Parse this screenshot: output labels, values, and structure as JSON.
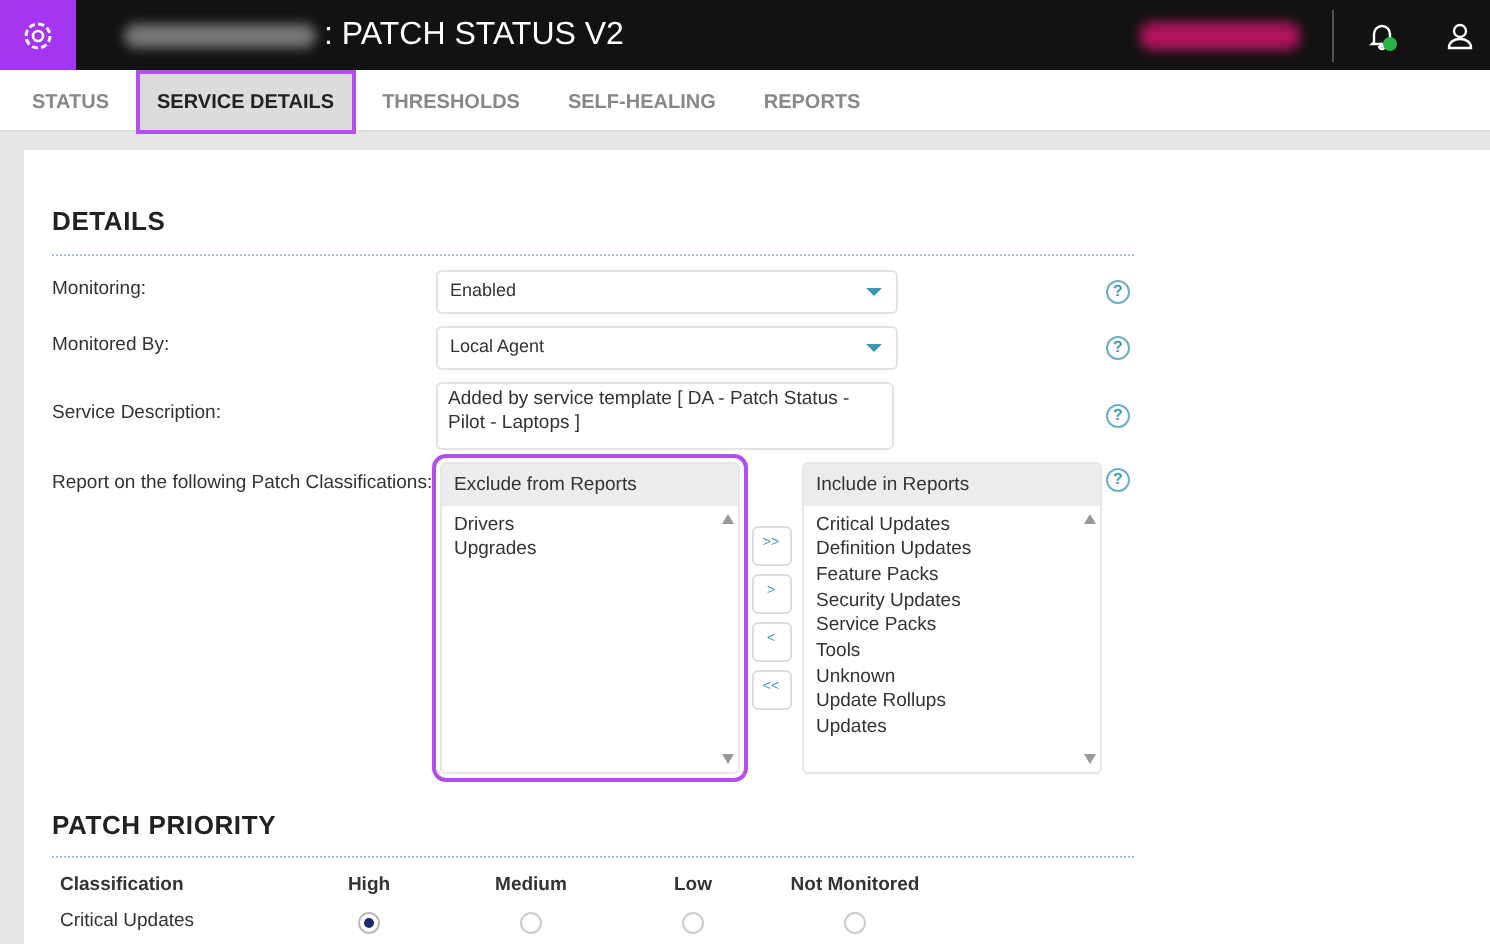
{
  "header": {
    "title": ": PATCH STATUS V2",
    "alerts_ok": true
  },
  "tabs": [
    {
      "label": "STATUS",
      "selected": false,
      "highlighted": false
    },
    {
      "label": "SERVICE DETAILS",
      "selected": true,
      "highlighted": true
    },
    {
      "label": "THRESHOLDS",
      "selected": false,
      "highlighted": false
    },
    {
      "label": "SELF-HEALING",
      "selected": false,
      "highlighted": false
    },
    {
      "label": "REPORTS",
      "selected": false,
      "highlighted": false
    }
  ],
  "details": {
    "heading": "DETAILS",
    "fields": [
      {
        "kind": "select",
        "label": "Monitoring:",
        "value": "Enabled",
        "help": "?"
      },
      {
        "kind": "select",
        "label": "Monitored By:",
        "value": "Local Agent",
        "help": "?"
      },
      {
        "kind": "textarea",
        "label": "Service Description:",
        "value": "Added by service template [ DA - Patch Status - Pilot - Laptops ]",
        "help": "?"
      },
      {
        "kind": "dual_list",
        "label": "Report on the following Patch Classifications:",
        "help": "?",
        "left": {
          "title": "Exclude from Reports",
          "highlighted": true,
          "items": [
            "Drivers",
            "Upgrades"
          ]
        },
        "right": {
          "title": "Include in Reports",
          "items": [
            "Critical Updates",
            "Definition Updates",
            "Feature Packs",
            "Security Updates",
            "Service Packs",
            "Tools",
            "Unknown",
            "Update Rollups",
            "Updates"
          ]
        },
        "buttons": [
          ">>",
          ">",
          "<",
          "<<"
        ]
      }
    ]
  },
  "priority": {
    "heading": "PATCH PRIORITY",
    "columns": [
      "Classification",
      "High",
      "Medium",
      "Low",
      "Not Monitored"
    ],
    "rows": [
      {
        "name": "Critical Updates",
        "choices": [
          {
            "selected": true
          },
          {
            "selected": false
          },
          {
            "selected": false
          },
          {
            "selected": false
          }
        ]
      }
    ]
  }
}
